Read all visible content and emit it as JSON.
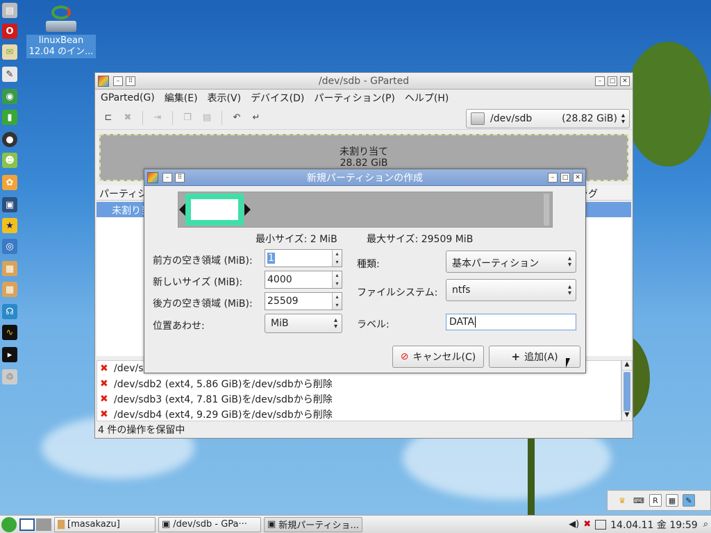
{
  "desktop_icon": {
    "label_line1": "linuxBean",
    "label_line2": "12.04 のイン..."
  },
  "main_window": {
    "title": "/dev/sdb - GParted",
    "menu": [
      "GParted(G)",
      "編集(E)",
      "表示(V)",
      "デバイス(D)",
      "パーティション(P)",
      "ヘルプ(H)"
    ],
    "device_combo": {
      "device": "/dev/sdb",
      "size": "(28.82 GiB)"
    },
    "partbar": {
      "label": "未割り当て",
      "size": "28.82 GiB"
    },
    "list_header_left": "パーティシ",
    "list_header_right": "ラグ",
    "list_selected_row": "未割り当",
    "operations": [
      "/dev/s",
      "/dev/sdb2 (ext4, 5.86 GiB)を/dev/sdbから削除",
      "/dev/sdb3 (ext4, 7.81 GiB)を/dev/sdbから削除",
      "/dev/sdb4 (ext4, 9.29 GiB)を/dev/sdbから削除"
    ],
    "status": "4 件の操作を保留中"
  },
  "dialog": {
    "title": "新規パーティションの作成",
    "min_size": "最小サイズ: 2 MiB",
    "max_size": "最大サイズ: 29509 MiB",
    "free_before_label": "前方の空き領域 (MiB):",
    "free_before_value": "1",
    "new_size_label": "新しいサイズ (MiB):",
    "new_size_value": "4000",
    "free_after_label": "後方の空き領域 (MiB):",
    "free_after_value": "25509",
    "align_label": "位置あわせ:",
    "align_value": "MiB",
    "type_label": "種類:",
    "type_value": "基本パーティション",
    "fs_label": "ファイルシステム:",
    "fs_value": "ntfs",
    "label_label": "ラベル:",
    "label_value": "DATA",
    "cancel_button": "キャンセル(C)",
    "add_button": "追加(A)"
  },
  "taskbar": {
    "items": [
      "[masakazu]",
      "/dev/sdb - GPa···",
      "新規パーティショ..."
    ],
    "clock": "14.04.11 金 19:59"
  }
}
